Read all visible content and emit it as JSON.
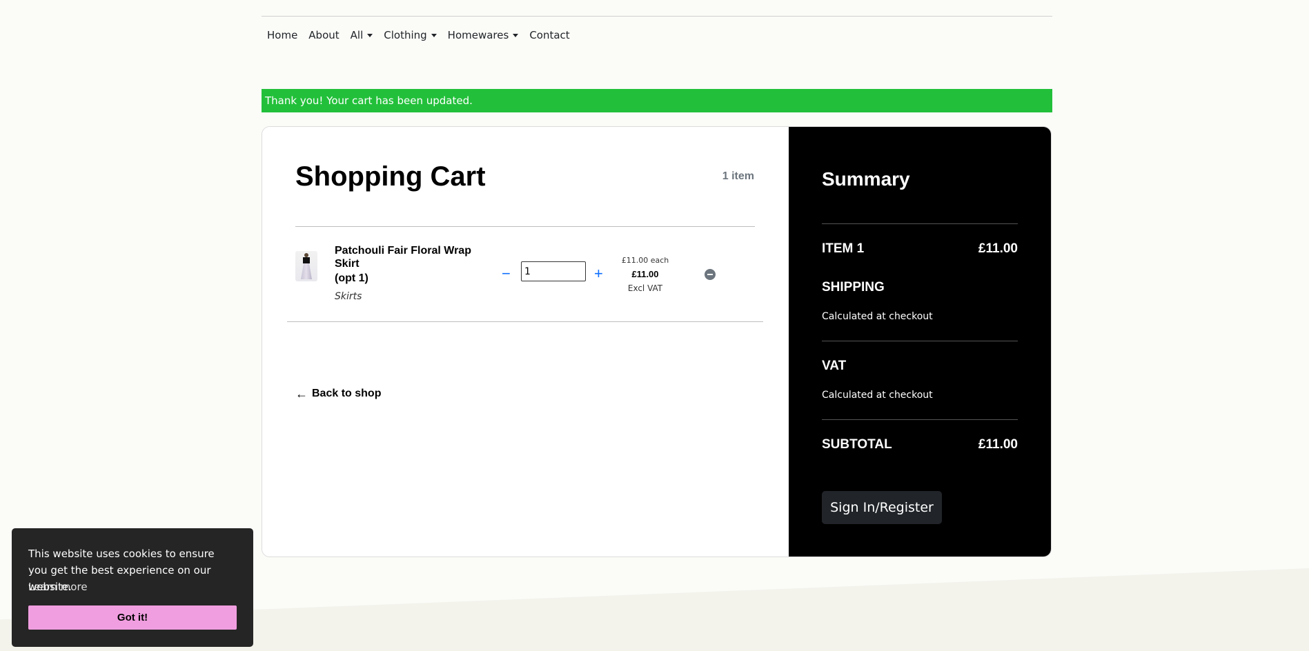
{
  "nav": {
    "items": [
      {
        "label": "Home"
      },
      {
        "label": "About"
      },
      {
        "label": "All"
      },
      {
        "label": "Clothing"
      },
      {
        "label": "Homewares"
      },
      {
        "label": "Contact"
      }
    ]
  },
  "alert": {
    "message": "Thank you! Your cart has been updated.",
    "color": "#22c03a"
  },
  "cart": {
    "title": "Shopping Cart",
    "count": "1 item",
    "items": [
      {
        "name": "Patchouli Fair Floral Wrap Skirt",
        "option": "(opt 1)",
        "category": "Skirts",
        "quantity": "1",
        "price_each": "£11.00 each",
        "price_total": "£11.00",
        "vat_note": "Excl VAT",
        "minus_symbol": "−",
        "plus_symbol": "+"
      }
    ],
    "back_link": "Back to shop",
    "back_icon": "←"
  },
  "summary": {
    "title": "Summary",
    "item_label": "ITEM 1",
    "item_value": "£11.00",
    "shipping_label": "SHIPPING",
    "shipping_note": "Calculated at checkout",
    "vat_label": "VAT",
    "vat_note": "Calculated at checkout",
    "subtotal_label": "SUBTOTAL",
    "subtotal_value": "£11.00",
    "signin_label": "Sign In/Register"
  },
  "cookie": {
    "message": "This website uses cookies to ensure you get the best experience on our website.",
    "learn_more": "Learn more",
    "button": "Got it!",
    "button_color": "#f19ee0"
  }
}
